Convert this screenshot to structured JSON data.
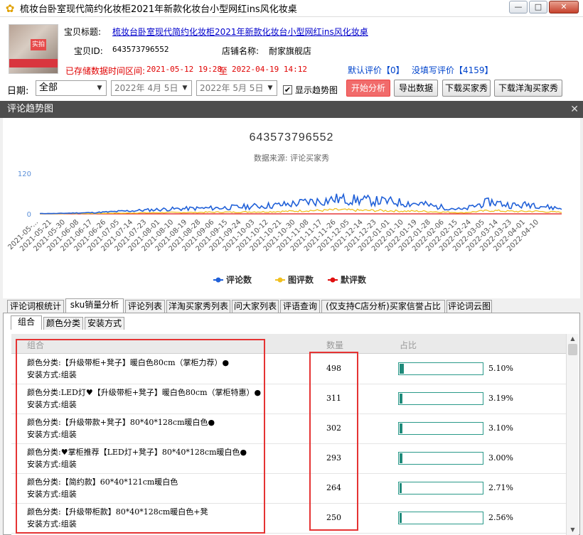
{
  "window": {
    "title": "梳妆台卧室现代简约化妆柜2021年新款化妆台小型网红ins风化妆桌",
    "min_label": "—",
    "max_label": "□",
    "close_label": "✕"
  },
  "product": {
    "title_label": "宝贝标题:",
    "title": "梳妆台卧室现代简约化妆柜2021年新款化妆台小型网红ins风化妆桌",
    "id_label": "宝贝ID:",
    "id": "643573796552",
    "shop_label": "店铺名称:",
    "shop": "耐家旗舰店",
    "range_label": "已存储数据时间区间:",
    "range_start": "2021-05-12 19:28",
    "range_to": "至",
    "range_end": "2022-04-19 14:12",
    "default_review": "默认评价【0】",
    "no_review": "没填写评价【4159】",
    "thumb_tag": "实拍"
  },
  "toolbar": {
    "date_label": "日期:",
    "date_range_value": "全部",
    "date_from": "2022年  4月  5日",
    "date_to": "2022年  5月  5日",
    "show_trend_label": "显示趋势图",
    "show_trend_checked": true,
    "start_btn": "开始分析",
    "export_btn": "导出数据",
    "download_buyer_btn": "下载买家秀",
    "download_foreign_btn": "下载洋淘买家秀"
  },
  "trend_panel": {
    "title": "评论趋势图",
    "close": "✕"
  },
  "chart_data": {
    "type": "line",
    "title": "643573796552",
    "subtitle": "数据来源: 评论买家秀",
    "yticks": [
      0,
      120
    ],
    "ylim": [
      0,
      120
    ],
    "x_labels": [
      "2021-05-...",
      "2021-05-21",
      "2021-05-30",
      "2021-06-08",
      "2021-06-17",
      "2021-06-26",
      "2021-07-05",
      "2021-07-14",
      "2021-07-23",
      "2021-08-01",
      "2021-08-10",
      "2021-08-19",
      "2021-08-28",
      "2021-09-06",
      "2021-09-15",
      "2021-09-24",
      "2021-10-03",
      "2021-10-12",
      "2021-10-21",
      "2021-10-30",
      "2021-11-08",
      "2021-11-17",
      "2021-11-26",
      "2021-12-05",
      "2021-12-14",
      "2021-12-23",
      "2022-01-01",
      "2022-01-10",
      "2022-01-19",
      "2022-01-28",
      "2022-02-06",
      "2022-02-15",
      "2022-02-24",
      "2022-03-05",
      "2022-03-14",
      "2022-03-23",
      "2022-04-01",
      "2022-04-10"
    ],
    "series": [
      {
        "name": "评论数",
        "color": "#2060d8",
        "values": [
          1,
          1,
          2,
          3,
          4,
          6,
          8,
          10,
          12,
          14,
          15,
          16,
          17,
          18,
          20,
          22,
          24,
          26,
          30,
          36,
          38,
          44,
          42,
          40,
          38,
          36,
          32,
          30,
          22,
          18,
          12,
          26,
          36,
          28,
          24,
          30,
          20,
          16
        ]
      },
      {
        "name": "图评数",
        "color": "#f0c020",
        "values": [
          0,
          0,
          1,
          1,
          1,
          2,
          2,
          3,
          3,
          4,
          4,
          4,
          5,
          5,
          5,
          6,
          6,
          7,
          8,
          10,
          10,
          12,
          11,
          10,
          10,
          9,
          8,
          8,
          6,
          5,
          3,
          7,
          10,
          8,
          7,
          8,
          6,
          5
        ]
      },
      {
        "name": "默评数",
        "color": "#e01010",
        "values": [
          0,
          0,
          0,
          0,
          0,
          0,
          0,
          0,
          0,
          0,
          0,
          0,
          0,
          0,
          0,
          0,
          0,
          0,
          0,
          0,
          0,
          0,
          0,
          0,
          0,
          0,
          0,
          0,
          0,
          0,
          0,
          0,
          0,
          0,
          0,
          0,
          0,
          0
        ]
      }
    ],
    "legend_position": "bottom"
  },
  "tabs": [
    "评论词根统计",
    "sku销量分析",
    "评论列表",
    "洋淘买家秀列表",
    "问大家列表",
    "评语查询",
    "(仅支持C店分析)买家信誉占比",
    "评论词云图"
  ],
  "active_tab": 1,
  "subtabs": [
    "组合",
    "颜色分类",
    "安装方式"
  ],
  "active_subtab": 0,
  "grid": {
    "headers": [
      "组合",
      "数量",
      "占比"
    ],
    "rows": [
      {
        "line1": "颜色分类:【升级带柜+凳子】暖白色80cm（掌柜力荐）●",
        "line2": "安装方式:组装",
        "count": "498",
        "pct": "5.10%",
        "ratio": 0.051
      },
      {
        "line1": "颜色分类:LED灯♥【升级带柜+凳子】暖白色80cm（掌柜特惠）●",
        "line2": "安装方式:组装",
        "count": "311",
        "pct": "3.19%",
        "ratio": 0.0319
      },
      {
        "line1": "颜色分类:【升级带款+凳子】80*40*128cm暖白色●",
        "line2": "安装方式:组装",
        "count": "302",
        "pct": "3.10%",
        "ratio": 0.031
      },
      {
        "line1": "颜色分类:♥掌柜推荐【LED灯+凳子】80*40*128cm暖白色●",
        "line2": "安装方式:组装",
        "count": "293",
        "pct": "3.00%",
        "ratio": 0.03
      },
      {
        "line1": "颜色分类:【简约款】60*40*121cm暖白色",
        "line2": "安装方式:组装",
        "count": "264",
        "pct": "2.71%",
        "ratio": 0.0271
      },
      {
        "line1": "颜色分类:【升级带柜款】80*40*128cm暖白色+凳",
        "line2": "安装方式:组装",
        "count": "250",
        "pct": "2.56%",
        "ratio": 0.0256
      }
    ]
  }
}
